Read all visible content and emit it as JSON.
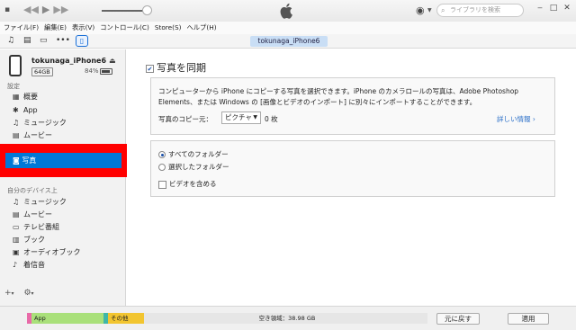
{
  "toolbar": {
    "search_placeholder": "ライブラリを検索",
    "window_buttons": [
      "‒",
      "□",
      "✕"
    ]
  },
  "menu": [
    "ファイル(F)",
    "編集(E)",
    "表示(V)",
    "コントロール(C)",
    "Store(S)",
    "ヘルプ(H)"
  ],
  "device_pill": "tokunaga_iPhone6",
  "device": {
    "name": "tokunaga_iPhone6",
    "capacity": "64GB",
    "battery": "84%"
  },
  "sidebar": {
    "settings_label": "設定",
    "settings_items": [
      {
        "label": "概要",
        "icon": "summary-icon"
      },
      {
        "label": "App",
        "icon": "app-icon"
      },
      {
        "label": "ミュージック",
        "icon": "music-icon"
      },
      {
        "label": "ムービー",
        "icon": "movie-icon"
      },
      {
        "label": "写真",
        "icon": "camera-icon"
      }
    ],
    "my_device_label": "自分のデバイス上",
    "device_items": [
      {
        "label": "ミュージック",
        "icon": "music-icon"
      },
      {
        "label": "ムービー",
        "icon": "movie-icon"
      },
      {
        "label": "テレビ番組",
        "icon": "tv-icon"
      },
      {
        "label": "ブック",
        "icon": "book-icon"
      },
      {
        "label": "オーディオブック",
        "icon": "audiobook-icon"
      },
      {
        "label": "着信音",
        "icon": "bell-icon"
      }
    ]
  },
  "main": {
    "sync_title": "写真を同期",
    "description": "コンピューターから iPhone にコピーする写真を選択できます。iPhone のカメラロールの写真は、Adobe Photoshop Elements、または Windows の [画像とビデオのインポート] に別々にインポートすることができます。",
    "copy_from_label": "写真のコピー元：",
    "copy_from_value": "ピクチャ",
    "copy_count": "0 枚",
    "more_info": "詳しい情報 ›",
    "options": [
      {
        "label": "すべてのフォルダー",
        "selected": true
      },
      {
        "label": "選択したフォルダー",
        "selected": false
      }
    ],
    "include_video": "ビデオを含める"
  },
  "storage": {
    "segments": [
      {
        "label": "",
        "color": "#e86aa8",
        "fraction": 0.012
      },
      {
        "label": "App",
        "color": "#a9e07a",
        "fraction": 0.18
      },
      {
        "label": "",
        "color": "#3fb6a8",
        "fraction": 0.012
      },
      {
        "label": "その他",
        "color": "#f2c530",
        "fraction": 0.09
      },
      {
        "label": "空き領域：38.98 GB",
        "color": "#e6e6e6",
        "fraction": 0.706
      }
    ]
  },
  "buttons": {
    "revert": "元に戻す",
    "apply": "適用"
  }
}
